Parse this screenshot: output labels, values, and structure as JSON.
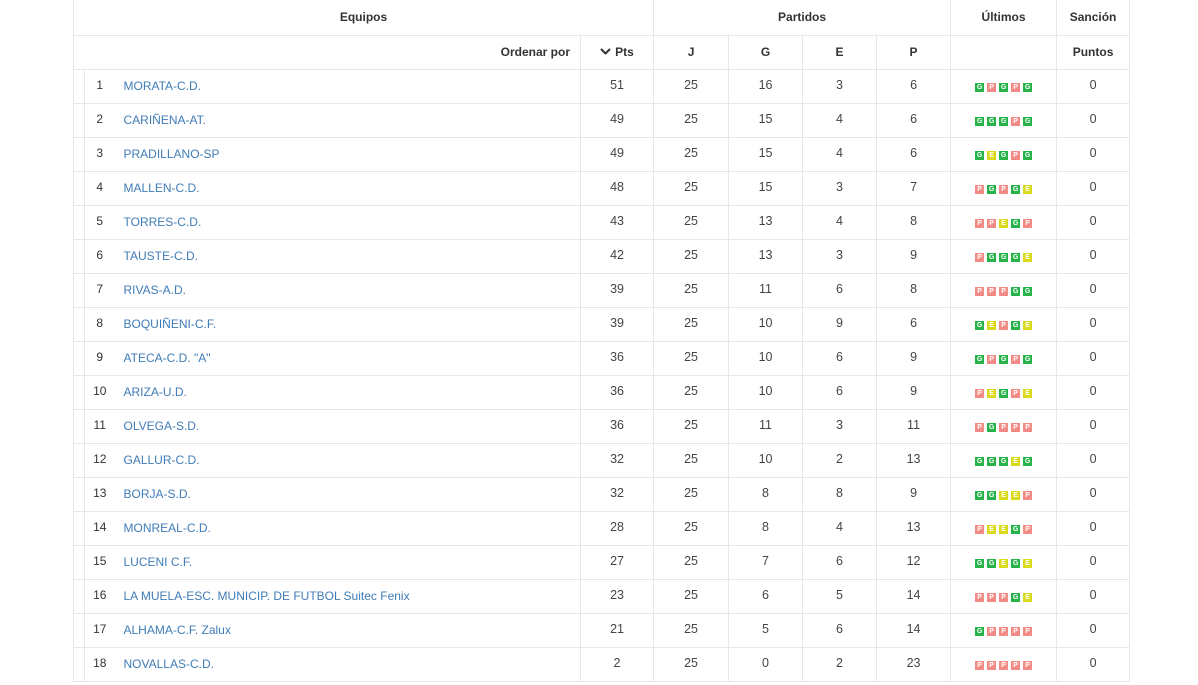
{
  "header": {
    "equipos": "Equipos",
    "partidos": "Partidos",
    "ultimos": "Últimos",
    "sancion": "Sanción",
    "ordenar_por": "Ordenar por",
    "pts": "Pts",
    "sort_icon": "chevron-down-icon",
    "j": "J",
    "g": "G",
    "e": "E",
    "p": "P",
    "puntos": "Puntos"
  },
  "colors": {
    "team_link": "#3f7cb7",
    "border": "#e7e7e7"
  },
  "result_colors": {
    "G": "#27b34a",
    "E": "#dada1c",
    "P": "#f28a86"
  },
  "rows": [
    {
      "pos": 1,
      "team": "MORATA-C.D.",
      "pts": 51,
      "j": 25,
      "g": 16,
      "e": 3,
      "p": 6,
      "last": [
        "G",
        "P",
        "G",
        "P",
        "G"
      ],
      "sancion": 0
    },
    {
      "pos": 2,
      "team": "CARIÑENA-AT.",
      "pts": 49,
      "j": 25,
      "g": 15,
      "e": 4,
      "p": 6,
      "last": [
        "G",
        "G",
        "G",
        "P",
        "G"
      ],
      "sancion": 0
    },
    {
      "pos": 3,
      "team": "PRADILLANO-SP",
      "pts": 49,
      "j": 25,
      "g": 15,
      "e": 4,
      "p": 6,
      "last": [
        "G",
        "E",
        "G",
        "P",
        "G"
      ],
      "sancion": 0
    },
    {
      "pos": 4,
      "team": "MALLEN-C.D.",
      "pts": 48,
      "j": 25,
      "g": 15,
      "e": 3,
      "p": 7,
      "last": [
        "P",
        "G",
        "P",
        "G",
        "E"
      ],
      "sancion": 0
    },
    {
      "pos": 5,
      "team": "TORRES-C.D.",
      "pts": 43,
      "j": 25,
      "g": 13,
      "e": 4,
      "p": 8,
      "last": [
        "P",
        "P",
        "E",
        "G",
        "P"
      ],
      "sancion": 0
    },
    {
      "pos": 6,
      "team": "TAUSTE-C.D.",
      "pts": 42,
      "j": 25,
      "g": 13,
      "e": 3,
      "p": 9,
      "last": [
        "P",
        "G",
        "G",
        "G",
        "E"
      ],
      "sancion": 0
    },
    {
      "pos": 7,
      "team": "RIVAS-A.D.",
      "pts": 39,
      "j": 25,
      "g": 11,
      "e": 6,
      "p": 8,
      "last": [
        "P",
        "P",
        "P",
        "G",
        "G"
      ],
      "sancion": 0
    },
    {
      "pos": 8,
      "team": "BOQUIÑENI-C.F.",
      "pts": 39,
      "j": 25,
      "g": 10,
      "e": 9,
      "p": 6,
      "last": [
        "G",
        "E",
        "P",
        "G",
        "E"
      ],
      "sancion": 0
    },
    {
      "pos": 9,
      "team": "ATECA-C.D. \"A\"",
      "pts": 36,
      "j": 25,
      "g": 10,
      "e": 6,
      "p": 9,
      "last": [
        "G",
        "P",
        "G",
        "P",
        "G"
      ],
      "sancion": 0
    },
    {
      "pos": 10,
      "team": "ARIZA-U.D.",
      "pts": 36,
      "j": 25,
      "g": 10,
      "e": 6,
      "p": 9,
      "last": [
        "P",
        "E",
        "G",
        "P",
        "E"
      ],
      "sancion": 0
    },
    {
      "pos": 11,
      "team": "OLVEGA-S.D.",
      "pts": 36,
      "j": 25,
      "g": 11,
      "e": 3,
      "p": 11,
      "last": [
        "P",
        "G",
        "P",
        "P",
        "P"
      ],
      "sancion": 0
    },
    {
      "pos": 12,
      "team": "GALLUR-C.D.",
      "pts": 32,
      "j": 25,
      "g": 10,
      "e": 2,
      "p": 13,
      "last": [
        "G",
        "G",
        "G",
        "E",
        "G"
      ],
      "sancion": 0
    },
    {
      "pos": 13,
      "team": "BORJA-S.D.",
      "pts": 32,
      "j": 25,
      "g": 8,
      "e": 8,
      "p": 9,
      "last": [
        "G",
        "G",
        "E",
        "E",
        "P"
      ],
      "sancion": 0
    },
    {
      "pos": 14,
      "team": "MONREAL-C.D.",
      "pts": 28,
      "j": 25,
      "g": 8,
      "e": 4,
      "p": 13,
      "last": [
        "P",
        "E",
        "E",
        "G",
        "P"
      ],
      "sancion": 0
    },
    {
      "pos": 15,
      "team": "LUCENI C.F.",
      "pts": 27,
      "j": 25,
      "g": 7,
      "e": 6,
      "p": 12,
      "last": [
        "G",
        "G",
        "E",
        "G",
        "E"
      ],
      "sancion": 0
    },
    {
      "pos": 16,
      "team": "LA MUELA-ESC. MUNICIP. DE FUTBOL Suitec Fenix",
      "pts": 23,
      "j": 25,
      "g": 6,
      "e": 5,
      "p": 14,
      "last": [
        "P",
        "P",
        "P",
        "G",
        "E"
      ],
      "sancion": 0
    },
    {
      "pos": 17,
      "team": "ALHAMA-C.F. Zalux",
      "pts": 21,
      "j": 25,
      "g": 5,
      "e": 6,
      "p": 14,
      "last": [
        "G",
        "P",
        "P",
        "P",
        "P"
      ],
      "sancion": 0
    },
    {
      "pos": 18,
      "team": "NOVALLAS-C.D.",
      "pts": 2,
      "j": 25,
      "g": 0,
      "e": 2,
      "p": 23,
      "last": [
        "P",
        "P",
        "P",
        "P",
        "P"
      ],
      "sancion": 0
    }
  ]
}
